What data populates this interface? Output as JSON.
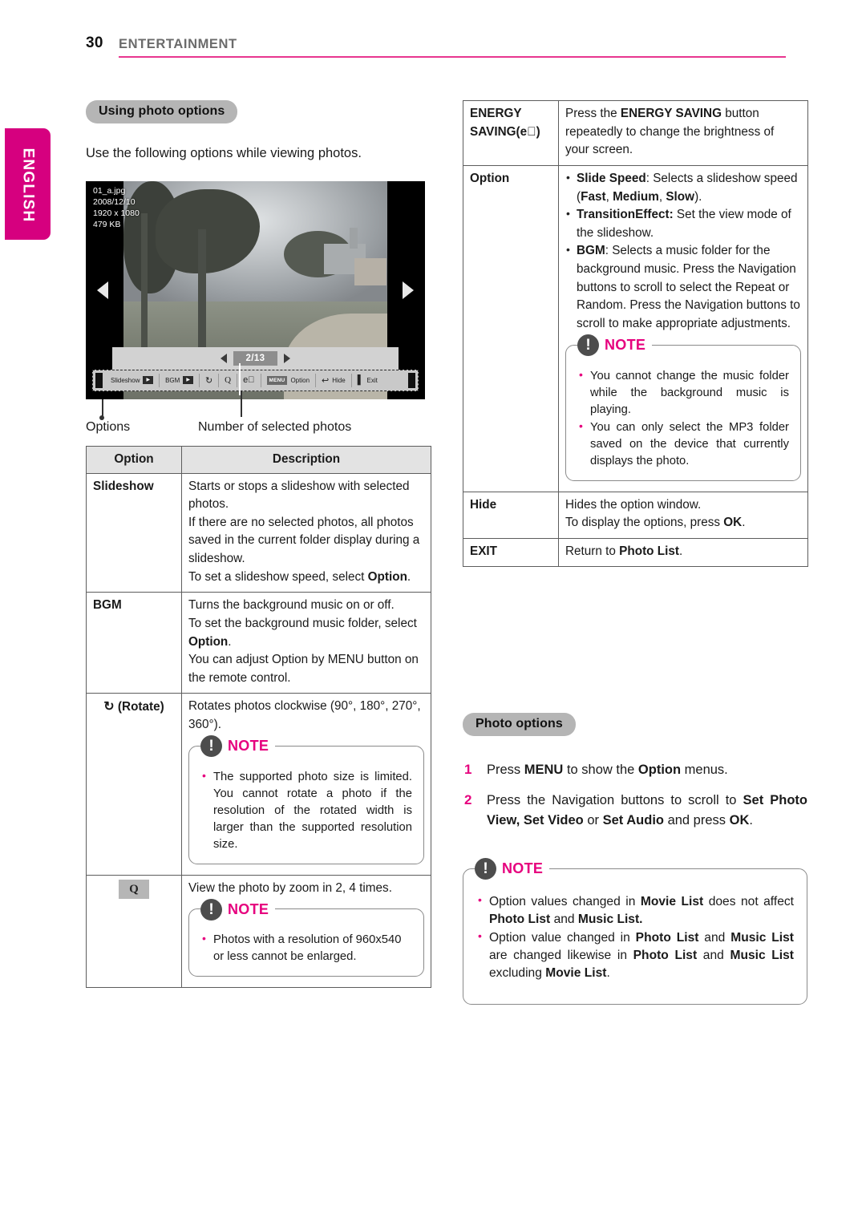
{
  "header": {
    "page_number": "30",
    "chapter": "ENTERTAINMENT"
  },
  "sidebar": {
    "language_tab": "ENGLISH"
  },
  "left_column": {
    "section_title": "Using photo options",
    "intro": "Use the following options while viewing photos.",
    "screenshot": {
      "file_name": "01_a.jpg",
      "date": "2008/12/10",
      "resolution": "1920 x 1080",
      "file_size": "479 KB",
      "counter": "2/13",
      "toolbar": [
        {
          "label": "Slideshow",
          "icon": "play-icon"
        },
        {
          "label": "BGM",
          "icon": "play-icon"
        },
        {
          "label": "",
          "icon": "rotate-icon"
        },
        {
          "label": "",
          "icon": "zoom-icon"
        },
        {
          "label": "",
          "icon": "energy-saving-icon"
        },
        {
          "label": "Option",
          "icon": "menu-badge"
        },
        {
          "label": "Hide",
          "icon": "hide-icon"
        },
        {
          "label": "Exit",
          "icon": "exit-icon"
        }
      ]
    },
    "captions": {
      "options": "Options",
      "number_of_selected": "Number of selected photos"
    },
    "table": {
      "headers": [
        "Option",
        "Description"
      ],
      "rows": [
        {
          "option": "Slideshow",
          "option_icon": "",
          "lines": [
            "Starts or stops a slideshow with selected photos.",
            "If there are no selected photos, all photos saved in the current folder display during a slideshow.",
            "To set a slideshow speed, select <b>Option</b>."
          ]
        },
        {
          "option": "BGM",
          "option_icon": "",
          "lines": [
            "Turns the background music on or off.",
            "To set the background music folder, select <b>Option</b>.",
            "You can adjust Option by MENU button on the remote control."
          ]
        },
        {
          "option": "(Rotate)",
          "option_icon": "rotate-icon",
          "lines": [
            "Rotates photos clockwise (90°, 180°, 270°, 360°)."
          ],
          "note": {
            "title": "NOTE",
            "items": [
              "The supported photo size is limited. You cannot rotate a photo if the resolution of the rotated width is larger than the supported resolution size."
            ]
          }
        },
        {
          "option": "",
          "option_icon": "zoom-icon",
          "lines": [
            "View the photo by zoom in 2, 4 times."
          ],
          "note": {
            "title": "NOTE",
            "items": [
              "Photos with a resolution of 960x540 or less cannot be enlarged."
            ]
          }
        }
      ]
    }
  },
  "right_column": {
    "table": {
      "rows": [
        {
          "option_line1": "ENERGY",
          "option_line2": "SAVING(",
          "option_icon": "energy-saving-icon",
          "option_line3": ")",
          "lines": [
            "Press the <b>ENERGY SAVING</b> button repeatedly to change the brightness of your screen."
          ]
        },
        {
          "option_line1": "Option",
          "bullets": [
            "<b>Slide Speed</b>: Selects a slideshow speed (<b>Fast</b>, <b>Medium</b>, <b>Slow</b>).",
            "<b>TransitionEffect:</b> Set the view mode of the slideshow.",
            "<b>BGM</b>: Selects a music folder for the background music. Press the Navigation buttons to scroll to select the Repeat or Random. Press the Navigation buttons to scroll to make appropriate adjustments."
          ],
          "note": {
            "title": "NOTE",
            "items": [
              "You cannot change the music folder while the background music is playing.",
              "You can only select the MP3 folder saved on the device that currently displays the photo."
            ]
          }
        },
        {
          "option_line1": "Hide",
          "lines": [
            "Hides the option window.",
            "To display the options, press <b>OK</b>."
          ]
        },
        {
          "option_line1": "EXIT",
          "lines": [
            "Return to <b>Photo List</b>."
          ]
        }
      ]
    },
    "section_title": "Photo options",
    "steps": [
      {
        "num": "1",
        "text": "Press <b>MENU</b> to show the <b>Option</b> menus."
      },
      {
        "num": "2",
        "text": "Press the Navigation buttons to scroll to <b>Set Photo View, Set Video</b> or <b>Set Audio</b> and press <b>OK</b>."
      }
    ],
    "note": {
      "title": "NOTE",
      "items": [
        "Option values changed in <b>Movie List</b> does not affect <b>Photo List</b> and <b>Music List.</b>",
        "Option value changed in <b>Photo List</b> and <b>Music List</b> are changed likewise in <b>Photo List</b> and <b>Music List</b> excluding <b>Movie List</b>."
      ]
    }
  },
  "colors": {
    "accent": "#e6007e",
    "tab": "#d6007f",
    "rule": "#e8368f",
    "pill": "#b5b5b5"
  }
}
